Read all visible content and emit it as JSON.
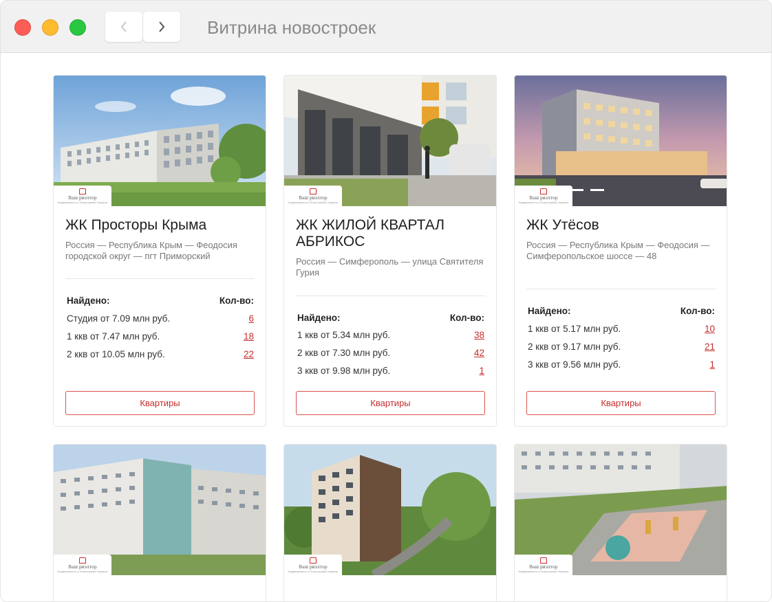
{
  "window": {
    "title": "Витрина новостроек"
  },
  "logo": {
    "line1": "Ваш риэлтор",
    "line2": "Недвижимость и Новостройки Украины"
  },
  "columns": {
    "found": "Найдено:",
    "qty": "Кол-во:"
  },
  "listings": [
    {
      "name": "ЖК Просторы Крыма",
      "address": "Россия — Республика Крым — Феодосия городской округ — пгт Приморский",
      "rows": [
        {
          "label": "Студия от 7.09 млн руб.",
          "count": "6"
        },
        {
          "label": "1 ккв от 7.47 млн руб.",
          "count": "18"
        },
        {
          "label": "2 ккв от 10.05 млн руб.",
          "count": "22"
        }
      ],
      "button": "Квартиры"
    },
    {
      "name": "ЖК ЖИЛОЙ КВАРТАЛ АБРИКОС",
      "address": "Россия — Симферополь — улица Святителя Гурия",
      "rows": [
        {
          "label": "1 ккв от 5.34 млн руб.",
          "count": "38"
        },
        {
          "label": "2 ккв от 7.30 млн руб.",
          "count": "42"
        },
        {
          "label": "3 ккв от 9.98 млн руб.",
          "count": "1"
        }
      ],
      "button": "Квартиры"
    },
    {
      "name": "ЖК Утёсов",
      "address": "Россия — Республика Крым — Феодосия — Симферопольское шоссе — 48",
      "rows": [
        {
          "label": "1 ккв от 5.17 млн руб.",
          "count": "10"
        },
        {
          "label": "2 ккв от 9.17 млн руб.",
          "count": "21"
        },
        {
          "label": "3 ккв от 9.56 млн руб.",
          "count": "1"
        }
      ],
      "button": "Квартиры"
    }
  ],
  "icons": {
    "back": "chevron-left-icon",
    "forward": "chevron-right-icon"
  },
  "colors": {
    "accent": "#c72c2c",
    "button_border": "#d9534f",
    "titlebar": "#f1f1f1"
  }
}
